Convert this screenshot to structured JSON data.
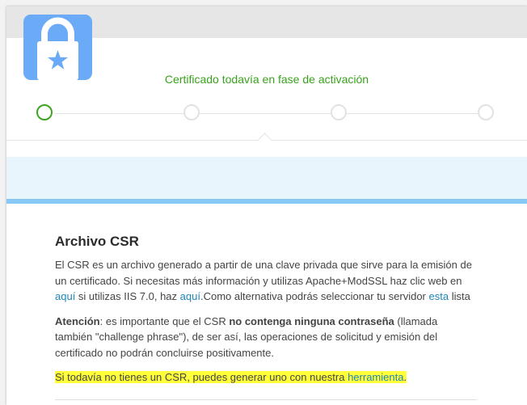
{
  "status": {
    "text": "Certificado todavía en fase de activación",
    "color": "#38a21b"
  },
  "icons": {
    "lock": "lock-star-icon"
  },
  "colors": {
    "accent_blue": "#6aaaf6",
    "banner_bg": "#e9f5fc",
    "banner_border": "#88c8f5",
    "active_step": "#3fa324",
    "link": "#1f86b8",
    "highlight": "#ffff3a"
  },
  "stepper": {
    "total_steps": 4,
    "active_step": 1
  },
  "section": {
    "title": "Archivo CSR",
    "p1": {
      "t1": "El CSR es un archivo generado a partir de una clave privada que sirve para la emisión de un certificado. Si necesitas más información y utilizas Apache+ModSSL haz clic web en ",
      "link1": "aquí",
      "t2": " si utilizas IIS 7.0, haz ",
      "link2": "aquí",
      "t3": ".Como alternativa podrás seleccionar tu servidor ",
      "link3": "esta",
      "t4": " lista"
    },
    "p2": {
      "label": "Atención",
      "t1": ": es importante que el CSR ",
      "bold": "no contenga ninguna contraseña",
      "t2": " (llamada también \"challenge phrase\"), de ser así, las operaciones de solicitud y emisión del certificado no podrán concluirse positivamente."
    },
    "p3": {
      "t1": "Si todavía no tienes un CSR, puedes generar uno con nuestra ",
      "link": "herramienta",
      "t2": "."
    }
  }
}
